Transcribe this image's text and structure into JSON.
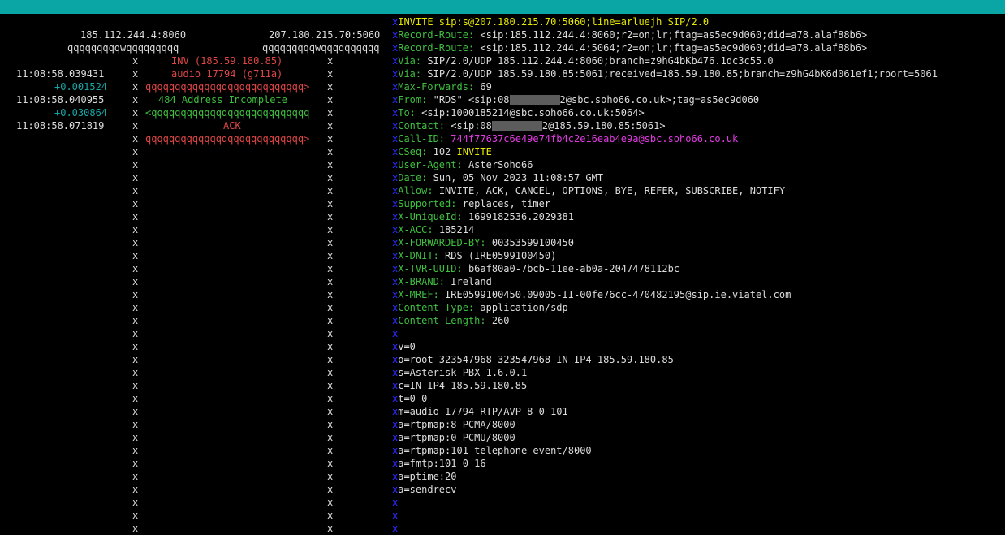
{
  "colors": {
    "topbar": "#0aa6a6",
    "time": "#dcdcdc",
    "delta": "#18a7a7",
    "request": "#e04646",
    "response": "#3fbf3f",
    "header_name": "#3fbf3f",
    "request_line": "#e6e600",
    "call_id": "#e23be2",
    "marker": "#2b2bff"
  },
  "ladder": {
    "host_left": "185.112.244.4:8060",
    "host_right": "207.180.215.70:5060",
    "lifeline_left": "qqqqqqqqqwqqqqqqqqq",
    "lifeline_right": "qqqqqqqqqwqqqqqqqqqq",
    "marker": "x",
    "rows": [
      {
        "time": "11:08:58.039431",
        "label": "INV (185.59.180.85)"
      },
      {
        "time": "+0.001524",
        "label": "audio 17794 (g711a)"
      },
      {
        "time": "11:08:58.040955",
        "arrow": "qqqqqqqqqqqqqqqqqqqqqqqqqqq>"
      },
      {
        "time": "+0.030864",
        "label": "484 Address Incomplete"
      },
      {
        "time": "11:08:58.071819",
        "arrow": "<qqqqqqqqqqqqqqqqqqqqqqqqqqq"
      },
      {
        "label": "ACK"
      },
      {
        "arrow": "qqqqqqqqqqqqqqqqqqqqqqqqqqq>"
      }
    ]
  },
  "message": {
    "marker": "x",
    "request_line": "INVITE sip:s@207.180.215.70:5060;line=arluejh SIP/2.0",
    "headers": [
      {
        "name": "Record-Route:",
        "value": "<sip:185.112.244.4:8060;r2=on;lr;ftag=as5ec9d060;did=a78.alaf88b6>"
      },
      {
        "name": "Record-Route:",
        "value": "<sip:185.112.244.4:5064;r2=on;lr;ftag=as5ec9d060;did=a78.alaf88b6>"
      },
      {
        "name": "Via:",
        "value": "SIP/2.0/UDP 185.112.244.4:8060;branch=z9hG4bKb476.1dc3c55.0"
      },
      {
        "name": "Via:",
        "value": "SIP/2.0/UDP 185.59.180.85:5061;received=185.59.180.85;branch=z9hG4bK6d061ef1;rport=5061"
      },
      {
        "name": "Max-Forwards:",
        "value": "69"
      },
      {
        "name": "From:",
        "value": "\"RDS\" <sip:08",
        "value2": "2@sbc.soho66.co.uk>;tag=as5ec9d060"
      },
      {
        "name": "To:",
        "value": "<sip:1000185214@sbc.soho66.co.uk:5064>"
      },
      {
        "name": "Contact:",
        "value": "<sip:08",
        "value2": "2@185.59.180.85:5061>"
      },
      {
        "name": "Call-ID:",
        "value": "744f77637c6e49e74fb4c2e16eab4e9a@sbc.soho66.co.uk"
      },
      {
        "name": "CSeq:",
        "value": "102 ",
        "method": "INVITE"
      },
      {
        "name": "User-Agent:",
        "value": "AsterSoho66"
      },
      {
        "name": "Date:",
        "value": "Sun, 05 Nov 2023 11:08:57 GMT"
      },
      {
        "name": "Allow:",
        "value": "INVITE, ACK, CANCEL, OPTIONS, BYE, REFER, SUBSCRIBE, NOTIFY"
      },
      {
        "name": "Supported:",
        "value": "replaces, timer"
      },
      {
        "name": "X-UniqueId:",
        "value": "1699182536.2029381"
      },
      {
        "name": "X-ACC:",
        "value": "185214"
      },
      {
        "name": "X-FORWARDED-BY:",
        "value": "00353599100450"
      },
      {
        "name": "X-DNIT:",
        "value": "RDS (IRE0599100450)"
      },
      {
        "name": "X-TVR-UUID:",
        "value": "b6af80a0-7bcb-11ee-ab0a-2047478112bc"
      },
      {
        "name": "X-BRAND:",
        "value": "Ireland"
      },
      {
        "name": "X-MREF:",
        "value": "IRE0599100450.09005-II-00fe76cc-470482195@sip.ie.viatel.com"
      },
      {
        "name": "Content-Type:",
        "value": "application/sdp"
      },
      {
        "name": "Content-Length:",
        "value": "260"
      }
    ],
    "sdp": [
      "v=0",
      "o=root 323547968 323547968 IN IP4 185.59.180.85",
      "s=Asterisk PBX 1.6.0.1",
      "c=IN IP4 185.59.180.85",
      "t=0 0",
      "m=audio 17794 RTP/AVP 8 0 101",
      "a=rtpmap:8 PCMA/8000",
      "a=rtpmap:0 PCMU/8000",
      "a=rtpmap:101 telephone-event/8000",
      "a=fmtp:101 0-16",
      "a=ptime:20",
      "a=sendrecv"
    ]
  }
}
